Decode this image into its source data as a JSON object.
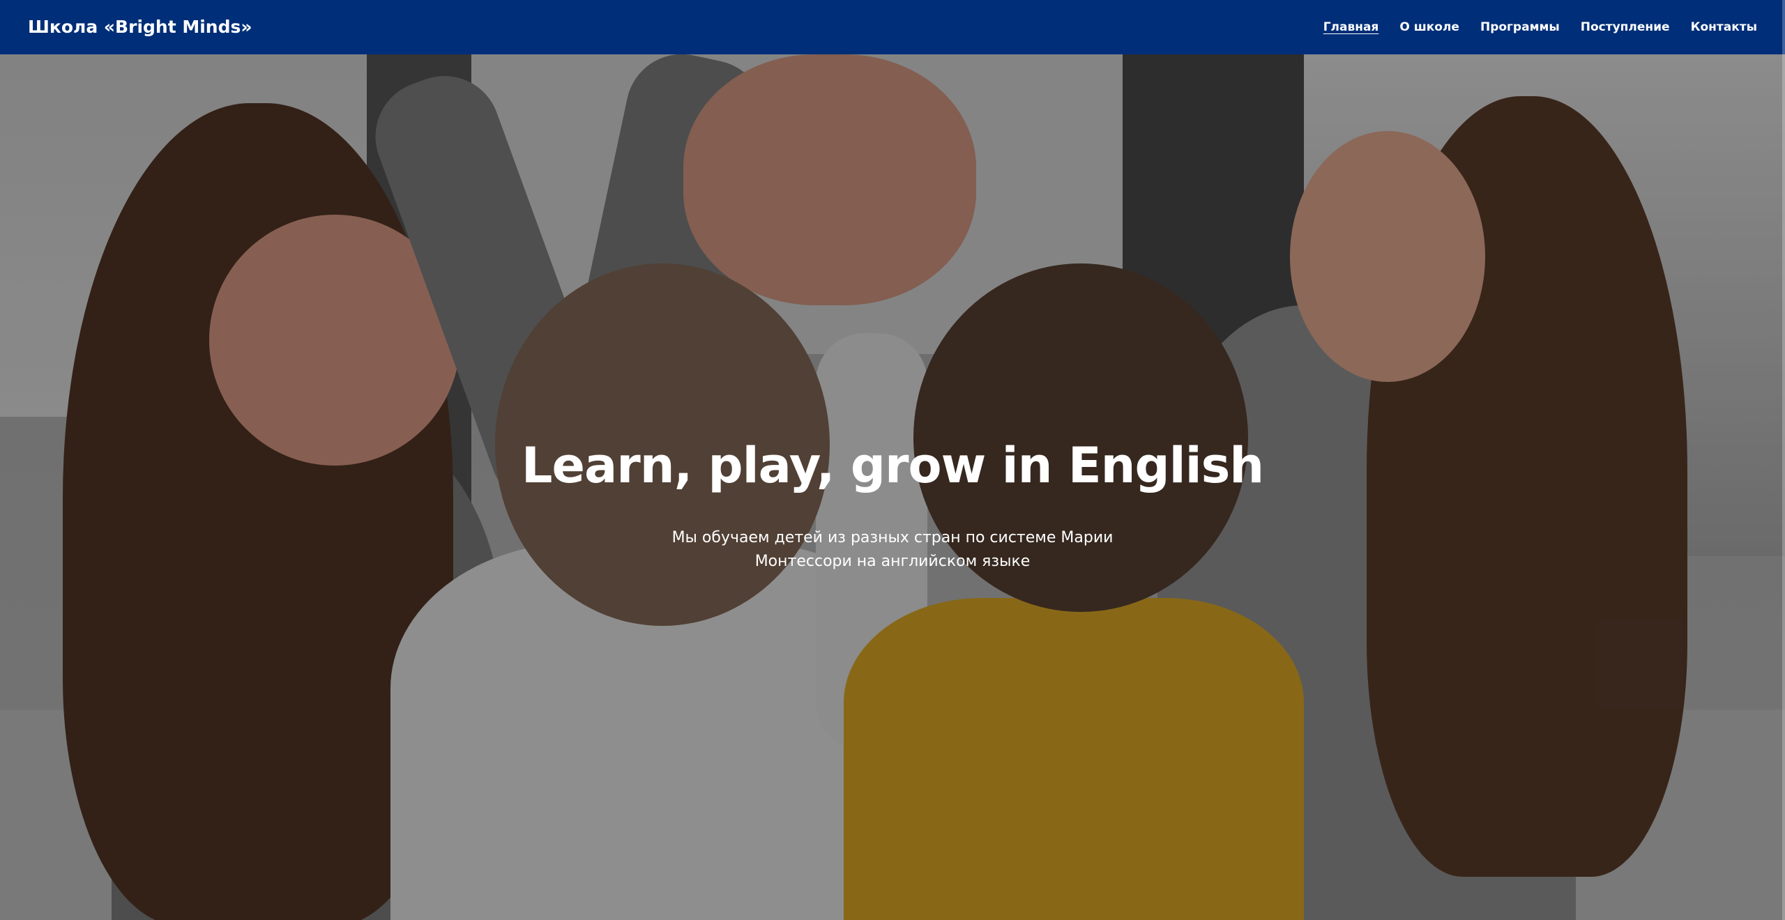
{
  "header": {
    "brand": "Школа «Bright Minds»",
    "nav": [
      {
        "label": "Главная",
        "active": true
      },
      {
        "label": "О школе",
        "active": false
      },
      {
        "label": "Программы",
        "active": false
      },
      {
        "label": "Поступление",
        "active": false
      },
      {
        "label": "Контакты",
        "active": false
      }
    ]
  },
  "hero": {
    "title": "Learn, play, grow in English",
    "subtitle": "Мы обучаем детей из разных стран по системе Марии Монтессори на английском языке"
  },
  "colors": {
    "navbar_background": "#002e78",
    "text": "#ffffff"
  }
}
